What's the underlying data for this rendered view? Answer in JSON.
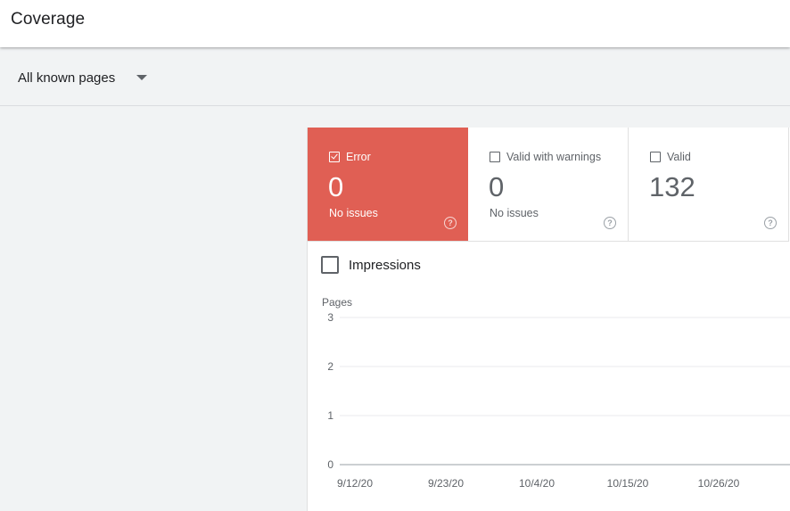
{
  "header": {
    "title": "Coverage"
  },
  "filter": {
    "selected": "All known pages"
  },
  "tiles": [
    {
      "label": "Error",
      "value": "0",
      "subtitle": "No issues",
      "checked": true,
      "active": true,
      "color": "#e05f54"
    },
    {
      "label": "Valid with warnings",
      "value": "0",
      "subtitle": "No issues",
      "checked": false,
      "active": false
    },
    {
      "label": "Valid",
      "value": "132",
      "subtitle": "",
      "checked": false,
      "active": false
    }
  ],
  "impressions": {
    "label": "Impressions",
    "checked": false
  },
  "chart_data": {
    "type": "line",
    "ylabel": "Pages",
    "ylim": [
      0,
      3
    ],
    "yticks": [
      "0",
      "1",
      "2",
      "3"
    ],
    "categories": [
      "9/12/20",
      "9/23/20",
      "10/4/20",
      "10/15/20",
      "10/26/20"
    ],
    "series": [],
    "grid": true
  }
}
